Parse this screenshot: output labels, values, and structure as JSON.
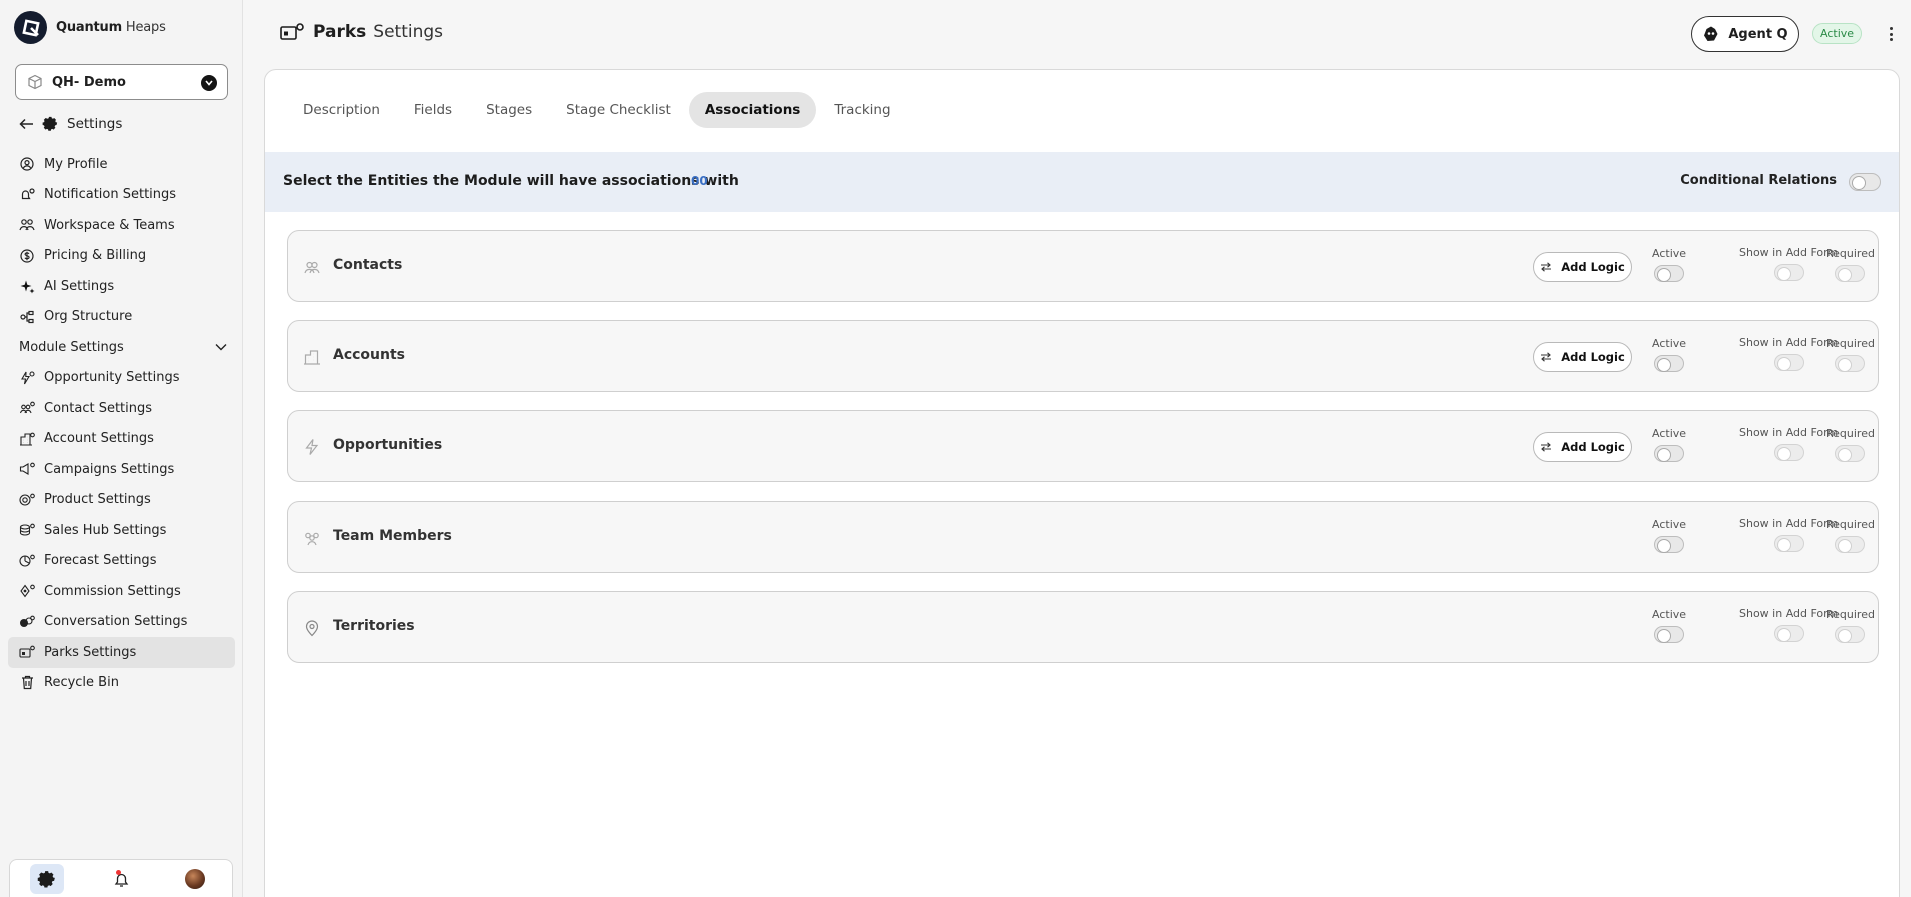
{
  "brand": {
    "name_bold": "Quantum",
    "name_rest": " Heaps"
  },
  "workspace": {
    "name": "QH- Demo"
  },
  "settings_header": {
    "label": "Settings"
  },
  "nav": {
    "items": [
      {
        "label": "My Profile",
        "icon": "user-circle-icon"
      },
      {
        "label": "Notification Settings",
        "icon": "bell-gear-icon"
      },
      {
        "label": "Workspace & Teams",
        "icon": "team-icon"
      },
      {
        "label": "Pricing & Billing",
        "icon": "dollar-circle-icon"
      },
      {
        "label": "AI Settings",
        "icon": "sparkle-icon"
      },
      {
        "label": "Org Structure",
        "icon": "org-tree-icon"
      }
    ],
    "section_label": "Module Settings",
    "module_items": [
      {
        "label": "Opportunity Settings",
        "icon": "bolt-gear-icon"
      },
      {
        "label": "Contact Settings",
        "icon": "contacts-gear-icon"
      },
      {
        "label": "Account Settings",
        "icon": "building-gear-icon"
      },
      {
        "label": "Campaigns Settings",
        "icon": "megaphone-gear-icon"
      },
      {
        "label": "Product Settings",
        "icon": "box-gear-icon"
      },
      {
        "label": "Sales Hub Settings",
        "icon": "hub-gear-icon"
      },
      {
        "label": "Forecast Settings",
        "icon": "forecast-gear-icon"
      },
      {
        "label": "Commission Settings",
        "icon": "commission-gear-icon"
      },
      {
        "label": "Conversation Settings",
        "icon": "chat-gear-icon"
      },
      {
        "label": "Parks Settings",
        "icon": "parks-gear-icon",
        "active": true
      }
    ],
    "recycle_label": "Recycle Bin"
  },
  "header": {
    "title": "Parks",
    "subtitle": "Settings",
    "agent_label": "Agent Q",
    "status_badge": "Active"
  },
  "tabs": [
    {
      "label": "Description"
    },
    {
      "label": "Fields"
    },
    {
      "label": "Stages"
    },
    {
      "label": "Stage Checklist"
    },
    {
      "label": "Associations",
      "active": true
    },
    {
      "label": "Tracking"
    }
  ],
  "associations": {
    "title": "Select the Entities the Module will have associations with",
    "count": "00",
    "conditional_label": "Conditional Relations",
    "column_labels": {
      "active": "Active",
      "show": "Show in Add Form",
      "required": "Required"
    },
    "add_logic_label": "Add Logic",
    "entities": [
      {
        "name": "Contacts",
        "icon": "contacts-icon",
        "has_logic": true
      },
      {
        "name": "Accounts",
        "icon": "building-icon",
        "has_logic": true
      },
      {
        "name": "Opportunities",
        "icon": "bolt-icon",
        "has_logic": true
      },
      {
        "name": "Team Members",
        "icon": "team-members-icon",
        "has_logic": false
      },
      {
        "name": "Territories",
        "icon": "location-pin-icon",
        "has_logic": false
      }
    ]
  },
  "colors": {
    "accent_blue": "#3a6fc4",
    "active_green": "#2a8a46",
    "band": "#e9eef6"
  }
}
